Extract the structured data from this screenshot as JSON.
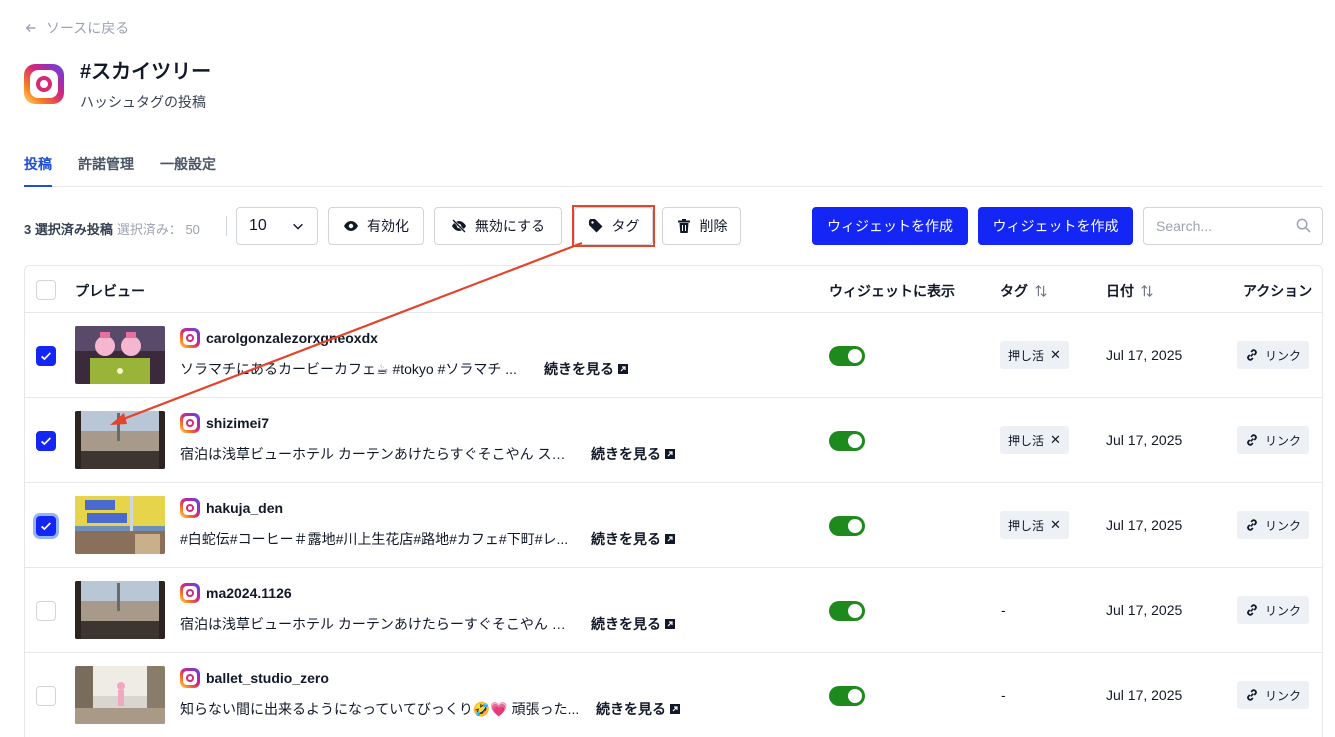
{
  "nav": {
    "back_label": "ソースに戻る"
  },
  "header": {
    "title": "#スカイツリー",
    "subtitle": "ハッシュタグの投稿"
  },
  "tabs": [
    {
      "label": "投稿",
      "active": true
    },
    {
      "label": "許諾管理",
      "active": false
    },
    {
      "label": "一般設定",
      "active": false
    }
  ],
  "toolbar": {
    "selected_text": "3 選択済み投稿",
    "selected_muted": "選択済み： 50",
    "page_size": "10",
    "enable_label": "有効化",
    "disable_label": "無効にする",
    "tag_label": "タグ",
    "delete_label": "削除",
    "create_widget_label_1": "ウィジェットを作成",
    "create_widget_label_2": "ウィジェットを作成",
    "search_placeholder": "Search..."
  },
  "table": {
    "columns": {
      "preview": "プレビュー",
      "show_in_widget": "ウィジェットに表示",
      "tags": "タグ",
      "date": "日付",
      "actions": "アクション"
    },
    "read_more_label": "続きを見る",
    "link_label": "リンク",
    "rows": [
      {
        "username": "carolgonzalezorxgneoxdx",
        "caption": "ソラマチにあるカービーカフェ☕ #tokyo #ソラマチ ...",
        "tag": "押し活",
        "date": "Jul 17, 2025",
        "checked": true,
        "enabled": true
      },
      {
        "username": "shizimei7",
        "caption": "宿泊は浅草ビューホテル カーテンあけたらすぐそこやん スカ...",
        "tag": "押し活",
        "date": "Jul 17, 2025",
        "checked": true,
        "enabled": true
      },
      {
        "username": "hakuja_den",
        "caption": "#白蛇伝#コーヒー＃露地#川上生花店#路地#カフェ#下町#レ...",
        "tag": "押し活",
        "date": "Jul 17, 2025",
        "checked": true,
        "enabled": true
      },
      {
        "username": "ma2024.1126",
        "caption": "宿泊は浅草ビューホテル カーテンあけたらーすぐそこやん ス...",
        "tag": "-",
        "date": "Jul 17, 2025",
        "checked": false,
        "enabled": true
      },
      {
        "username": "ballet_studio_zero",
        "caption": "知らない間に出来るようになっていてびっくり🤣💗 頑張った...",
        "tag": "-",
        "date": "Jul 17, 2025",
        "checked": false,
        "enabled": true
      }
    ]
  },
  "colors": {
    "primary": "#1326f5",
    "toggle_on": "#1e8a1e",
    "annotation": "#e2452c",
    "active_tab": "#1d4ed8"
  },
  "icons": [
    "arrow-left-icon",
    "instagram-icon",
    "chevron-down-icon",
    "eye-icon",
    "eye-off-icon",
    "tag-icon",
    "trash-icon",
    "search-icon",
    "sort-icon",
    "external-link-icon",
    "link-icon",
    "check-icon"
  ]
}
